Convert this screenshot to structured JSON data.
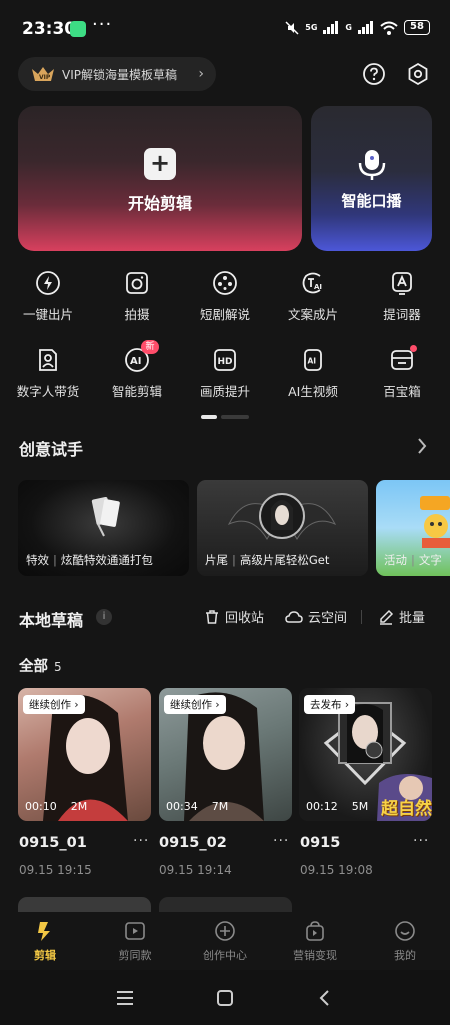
{
  "status_bar": {
    "time": "23:30",
    "dots": "···",
    "signal1": "5G",
    "signal2": "G",
    "battery": "58"
  },
  "vip": {
    "label": "VIP解锁海量模板草稿",
    "chevron": "›",
    "icon": "vip-crown-icon"
  },
  "header_icons": [
    "help-icon",
    "settings-icon"
  ],
  "main_cards": {
    "start_edit": "开始剪辑",
    "smart_broadcast": "智能口播"
  },
  "tools_row1": [
    {
      "label": "一键出片",
      "icon": "lightning-icon"
    },
    {
      "label": "拍摄",
      "icon": "camera-icon"
    },
    {
      "label": "短剧解说",
      "icon": "film-reel-icon"
    },
    {
      "label": "文案成片",
      "icon": "text-ai-icon"
    },
    {
      "label": "提词器",
      "icon": "prompter-icon"
    }
  ],
  "tools_row2": [
    {
      "label": "数字人带货",
      "icon": "digital-human-icon"
    },
    {
      "label": "智能剪辑",
      "icon": "ai-edit-icon",
      "badge": "新"
    },
    {
      "label": "画质提升",
      "icon": "hd-icon"
    },
    {
      "label": "AI生视频",
      "icon": "ai-video-icon"
    },
    {
      "label": "百宝箱",
      "icon": "toolbox-icon"
    }
  ],
  "creative": {
    "title": "创意试手",
    "tiles": [
      {
        "tag": "特效",
        "text": "炫酷特效通通打包"
      },
      {
        "tag": "片尾",
        "text": "高级片尾轻松Get"
      },
      {
        "tag": "活动",
        "text": "文字"
      }
    ]
  },
  "drafts": {
    "title": "本地草稿",
    "info": "i",
    "recycle": "回收站",
    "cloud": "云空间",
    "batch": "批量",
    "filter_label": "全部",
    "count": "5",
    "items": [
      {
        "tag": "继续创作 ›",
        "duration": "00:10",
        "size": "2M",
        "name": "0915_01",
        "date": "09.15 19:15"
      },
      {
        "tag": "继续创作 ›",
        "duration": "00:34",
        "size": "7M",
        "name": "0915_02",
        "date": "09.15 19:14"
      },
      {
        "tag": "去发布 ›",
        "duration": "00:12",
        "size": "5M",
        "name": "0915",
        "date": "09.15 19:08",
        "overlay": "超自然"
      }
    ],
    "more": "···"
  },
  "bottom_nav": [
    {
      "label": "剪辑",
      "icon": "scissors-icon",
      "active": true
    },
    {
      "label": "剪同款",
      "icon": "template-icon"
    },
    {
      "label": "创作中心",
      "icon": "creator-icon"
    },
    {
      "label": "营销变现",
      "icon": "bag-icon"
    },
    {
      "label": "我的",
      "icon": "profile-icon"
    }
  ],
  "colors": {
    "bg": "#151515",
    "accent_red": "#ff4d6a",
    "nav_active": "#f2c744",
    "nav_inactive": "#8a8a8a"
  }
}
